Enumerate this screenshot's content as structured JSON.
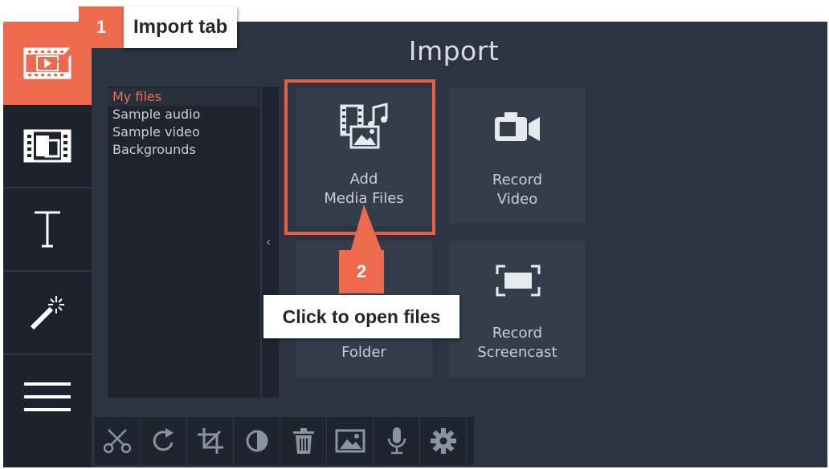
{
  "window": {
    "title": "Import"
  },
  "sidebar": {
    "items": [
      {
        "name": "import",
        "icon": "film-play-icon",
        "active": true
      },
      {
        "name": "transitions",
        "icon": "film-transition-icon"
      },
      {
        "name": "titles",
        "icon": "text-t-icon"
      },
      {
        "name": "filters",
        "icon": "magic-wand-icon"
      },
      {
        "name": "more",
        "icon": "hamburger-menu-icon"
      }
    ]
  },
  "file_list": {
    "items": [
      "My files",
      "Sample audio",
      "Sample video",
      "Backgrounds"
    ],
    "selected": "My files",
    "collapse_glyph": "‹"
  },
  "tiles": {
    "add_media": {
      "line1": "Add",
      "line2": "Media Files",
      "icon": "media-files-icon"
    },
    "record_video": {
      "line1": "Record",
      "line2": "Video",
      "icon": "camcorder-icon"
    },
    "add_folder": {
      "line1": "Folder",
      "icon": "folder-icon"
    },
    "record_screencast": {
      "line1": "Record",
      "line2": "Screencast",
      "icon": "screencast-icon"
    }
  },
  "toolbar": {
    "buttons": [
      "scissors-icon",
      "rotate-icon",
      "crop-icon",
      "color-adjust-icon",
      "trash-icon",
      "image-icon",
      "microphone-icon",
      "gear-icon"
    ]
  },
  "callouts": {
    "step1": {
      "number": "1",
      "text": "Import tab"
    },
    "step2": {
      "number": "2",
      "text": "Click to open files"
    }
  },
  "colors": {
    "accent": "#ee6a4f",
    "panel": "#2b3440",
    "sidebar": "#1c232c",
    "tile": "#343e4b",
    "text": "#c9ced5"
  }
}
